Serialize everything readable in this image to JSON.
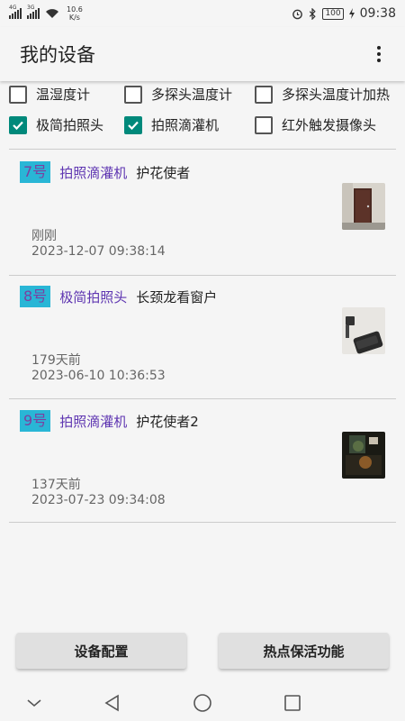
{
  "status_bar": {
    "net_tag_1": "4G",
    "net_tag_2": "3G",
    "speed_value": "10.6",
    "speed_unit": "K/s",
    "battery": "100",
    "time": "09:38"
  },
  "app_bar": {
    "title": "我的设备"
  },
  "filters": [
    {
      "label": "温湿度计",
      "checked": false
    },
    {
      "label": "多探头温度计",
      "checked": false
    },
    {
      "label": "多探头温度计加热",
      "checked": false
    },
    {
      "label": "极简拍照头",
      "checked": true
    },
    {
      "label": "拍照滴灌机",
      "checked": true
    },
    {
      "label": "红外触发摄像头",
      "checked": false
    }
  ],
  "devices": [
    {
      "number": "7号",
      "type": "拍照滴灌机",
      "name": "护花使者",
      "ago": "刚刚",
      "time": "2023-12-07 09:38:14",
      "thumb": "door-photo"
    },
    {
      "number": "8号",
      "type": "极简拍照头",
      "name": "长颈龙看窗户",
      "ago": "179天前",
      "time": "2023-06-10 10:36:53",
      "thumb": "device-photo"
    },
    {
      "number": "9号",
      "type": "拍照滴灌机",
      "name": "护花使者2",
      "ago": "137天前",
      "time": "2023-07-23 09:34:08",
      "thumb": "plant-photo"
    }
  ],
  "buttons": {
    "device_config": "设备配置",
    "hotspot_keepalive": "热点保活功能"
  },
  "colors": {
    "checkbox_checked": "#00897b",
    "badge_bg": "#29b6d6",
    "badge_text": "#7b3fa0",
    "type_text": "#5e35b1"
  }
}
